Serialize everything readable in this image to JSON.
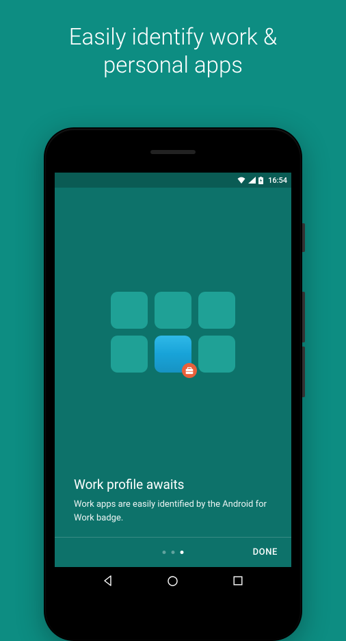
{
  "promo": {
    "title": "Easily identify work & personal apps"
  },
  "status_bar": {
    "time": "16:54"
  },
  "onboarding": {
    "heading": "Work profile awaits",
    "body": "Work apps are easily identified by the Android for Work badge.",
    "done_label": "DONE"
  },
  "pager": {
    "total": 3,
    "active_index": 2
  }
}
